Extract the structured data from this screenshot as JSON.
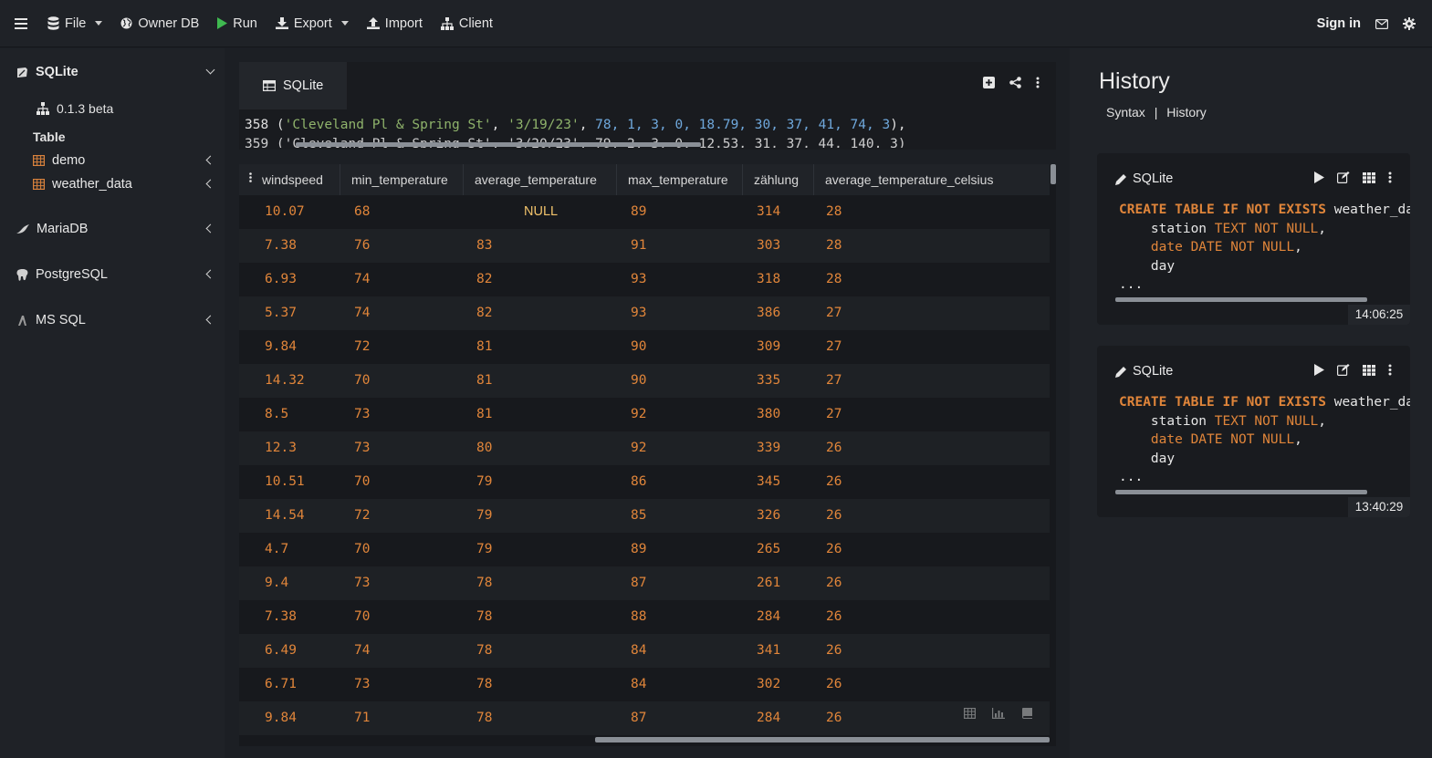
{
  "topbar": {
    "file": "File",
    "owner_db": "Owner DB",
    "run": "Run",
    "export": "Export",
    "import": "Import",
    "client": "Client",
    "sign_in": "Sign in"
  },
  "sidebar": {
    "sqlite": "SQLite",
    "version": "0.1.3 beta",
    "table_heading": "Table",
    "tables": [
      "demo",
      "weather_data"
    ],
    "mariadb": "MariaDB",
    "postgresql": "PostgreSQL",
    "mssql": "MS SQL"
  },
  "editor": {
    "tab_label": "SQLite",
    "line1": {
      "num": "358",
      "station": "'Cleveland Pl & Spring St'",
      "date": "'3/19/23'",
      "values": "78, 1, 3, 0, 18.79, 30, 37, 41, 74, 3"
    },
    "line2_partial": "359 ('Cleveland Pl & Spring St', '3/20/23', 79, 2, 3, 0, 12.53, 31, 37, 44, 140, 3)"
  },
  "grid": {
    "columns": [
      "windspeed",
      "min_temperature",
      "average_temperature",
      "max_temperature",
      "zählung",
      "average_temperature_celsius"
    ],
    "rows": [
      [
        "10.07",
        "68",
        "NULL",
        "89",
        "314",
        "28"
      ],
      [
        "7.38",
        "76",
        "83",
        "91",
        "303",
        "28"
      ],
      [
        "6.93",
        "74",
        "82",
        "93",
        "318",
        "28"
      ],
      [
        "5.37",
        "74",
        "82",
        "93",
        "386",
        "27"
      ],
      [
        "9.84",
        "72",
        "81",
        "90",
        "309",
        "27"
      ],
      [
        "14.32",
        "70",
        "81",
        "90",
        "335",
        "27"
      ],
      [
        "8.5",
        "73",
        "81",
        "92",
        "380",
        "27"
      ],
      [
        "12.3",
        "73",
        "80",
        "92",
        "339",
        "26"
      ],
      [
        "10.51",
        "70",
        "79",
        "86",
        "345",
        "26"
      ],
      [
        "14.54",
        "72",
        "79",
        "85",
        "326",
        "26"
      ],
      [
        "4.7",
        "70",
        "79",
        "89",
        "265",
        "26"
      ],
      [
        "9.4",
        "73",
        "78",
        "87",
        "261",
        "26"
      ],
      [
        "7.38",
        "70",
        "78",
        "88",
        "284",
        "26"
      ],
      [
        "6.49",
        "74",
        "78",
        "84",
        "341",
        "26"
      ],
      [
        "6.71",
        "73",
        "78",
        "84",
        "302",
        "26"
      ],
      [
        "9.84",
        "71",
        "78",
        "87",
        "284",
        "26"
      ]
    ]
  },
  "history": {
    "title": "History",
    "tab_syntax": "Syntax",
    "tab_sep": "|",
    "tab_history": "History",
    "entries": [
      {
        "engine": "SQLite",
        "time": "14:06:25",
        "kw_create": "CREATE TABLE IF NOT EXISTS",
        "table_name": "weather_da",
        "col1": "station",
        "col1_type": "TEXT",
        "col2": "date",
        "col2_type": "DATE",
        "not_null": "NOT NULL",
        "col3": "day",
        "ellipsis": "..."
      },
      {
        "engine": "SQLite",
        "time": "13:40:29",
        "kw_create": "CREATE TABLE IF NOT EXISTS",
        "table_name": "weather_da",
        "col1": "station",
        "col1_type": "TEXT",
        "col2": "date",
        "col2_type": "DATE",
        "not_null": "NOT NULL",
        "col3": "day",
        "ellipsis": "..."
      }
    ]
  }
}
